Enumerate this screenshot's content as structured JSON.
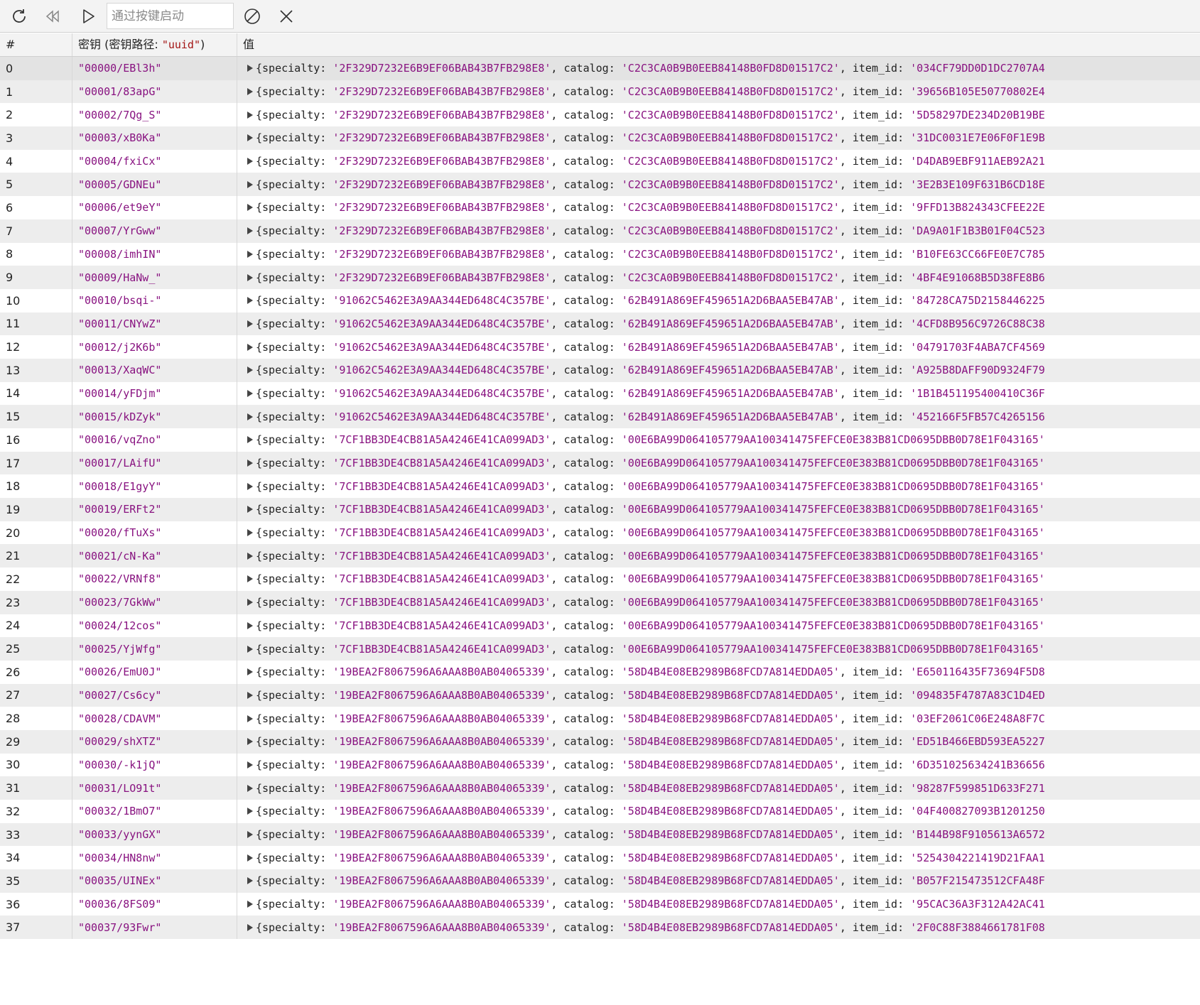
{
  "toolbar": {
    "refresh_icon": "refresh-icon",
    "rewind_icon": "rewind-icon",
    "play_icon": "play-icon",
    "filter_placeholder": "通过按键启动",
    "clear_icon": "clear-icon",
    "close_icon": "close-icon"
  },
  "columns": {
    "index": "#",
    "key_prefix": "密钥 (密钥路径: ",
    "key_path": "\"uuid\"",
    "key_suffix": ")",
    "value": "值"
  },
  "rows": [
    {
      "index": "0",
      "key": "\"00000/EBl3h\"",
      "specialty": "'2F329D7232E6B9EF06BAB43B7FB298E8'",
      "catalog": "'C2C3CA0B9B0EEB84148B0FD8D01517C2'",
      "item_id": "'034CF79DD0D1DC2707A4"
    },
    {
      "index": "1",
      "key": "\"00001/83apG\"",
      "specialty": "'2F329D7232E6B9EF06BAB43B7FB298E8'",
      "catalog": "'C2C3CA0B9B0EEB84148B0FD8D01517C2'",
      "item_id": "'39656B105E50770802E4"
    },
    {
      "index": "2",
      "key": "\"00002/7Qg_S\"",
      "specialty": "'2F329D7232E6B9EF06BAB43B7FB298E8'",
      "catalog": "'C2C3CA0B9B0EEB84148B0FD8D01517C2'",
      "item_id": "'5D58297DE234D20B19BE"
    },
    {
      "index": "3",
      "key": "\"00003/xB0Ka\"",
      "specialty": "'2F329D7232E6B9EF06BAB43B7FB298E8'",
      "catalog": "'C2C3CA0B9B0EEB84148B0FD8D01517C2'",
      "item_id": "'31DC0031E7E06F0F1E9B"
    },
    {
      "index": "4",
      "key": "\"00004/fxiCx\"",
      "specialty": "'2F329D7232E6B9EF06BAB43B7FB298E8'",
      "catalog": "'C2C3CA0B9B0EEB84148B0FD8D01517C2'",
      "item_id": "'D4DAB9EBF911AEB92A21"
    },
    {
      "index": "5",
      "key": "\"00005/GDNEu\"",
      "specialty": "'2F329D7232E6B9EF06BAB43B7FB298E8'",
      "catalog": "'C2C3CA0B9B0EEB84148B0FD8D01517C2'",
      "item_id": "'3E2B3E109F631B6CD18E"
    },
    {
      "index": "6",
      "key": "\"00006/et9eY\"",
      "specialty": "'2F329D7232E6B9EF06BAB43B7FB298E8'",
      "catalog": "'C2C3CA0B9B0EEB84148B0FD8D01517C2'",
      "item_id": "'9FFD13B824343CFEE22E"
    },
    {
      "index": "7",
      "key": "\"00007/YrGww\"",
      "specialty": "'2F329D7232E6B9EF06BAB43B7FB298E8'",
      "catalog": "'C2C3CA0B9B0EEB84148B0FD8D01517C2'",
      "item_id": "'DA9A01F1B3B01F04C523"
    },
    {
      "index": "8",
      "key": "\"00008/imhIN\"",
      "specialty": "'2F329D7232E6B9EF06BAB43B7FB298E8'",
      "catalog": "'C2C3CA0B9B0EEB84148B0FD8D01517C2'",
      "item_id": "'B10FE63CC66FE0E7C785"
    },
    {
      "index": "9",
      "key": "\"00009/HaNw_\"",
      "specialty": "'2F329D7232E6B9EF06BAB43B7FB298E8'",
      "catalog": "'C2C3CA0B9B0EEB84148B0FD8D01517C2'",
      "item_id": "'4BF4E91068B5D38FE8B6"
    },
    {
      "index": "10",
      "key": "\"00010/bsqi-\"",
      "specialty": "'91062C5462E3A9AA344ED648C4C357BE'",
      "catalog": "'62B491A869EF459651A2D6BAA5EB47AB'",
      "item_id": "'84728CA75D2158446225"
    },
    {
      "index": "11",
      "key": "\"00011/CNYwZ\"",
      "specialty": "'91062C5462E3A9AA344ED648C4C357BE'",
      "catalog": "'62B491A869EF459651A2D6BAA5EB47AB'",
      "item_id": "'4CFD8B956C9726C88C38"
    },
    {
      "index": "12",
      "key": "\"00012/j2K6b\"",
      "specialty": "'91062C5462E3A9AA344ED648C4C357BE'",
      "catalog": "'62B491A869EF459651A2D6BAA5EB47AB'",
      "item_id": "'04791703F4ABA7CF4569"
    },
    {
      "index": "13",
      "key": "\"00013/XaqWC\"",
      "specialty": "'91062C5462E3A9AA344ED648C4C357BE'",
      "catalog": "'62B491A869EF459651A2D6BAA5EB47AB'",
      "item_id": "'A925B8DAFF90D9324F79"
    },
    {
      "index": "14",
      "key": "\"00014/yFDjm\"",
      "specialty": "'91062C5462E3A9AA344ED648C4C357BE'",
      "catalog": "'62B491A869EF459651A2D6BAA5EB47AB'",
      "item_id": "'1B1B451195400410C36F"
    },
    {
      "index": "15",
      "key": "\"00015/kDZyk\"",
      "specialty": "'91062C5462E3A9AA344ED648C4C357BE'",
      "catalog": "'62B491A869EF459651A2D6BAA5EB47AB'",
      "item_id": "'452166F5FB57C4265156"
    },
    {
      "index": "16",
      "key": "\"00016/vqZno\"",
      "specialty": "'7CF1BB3DE4CB81A5A4246E41CA099AD3'",
      "catalog": "'00E6BA99D064105779AA100341475FEFCE0E383B81CD0695DBB0D78E1F043165'",
      "item_id": ""
    },
    {
      "index": "17",
      "key": "\"00017/LAifU\"",
      "specialty": "'7CF1BB3DE4CB81A5A4246E41CA099AD3'",
      "catalog": "'00E6BA99D064105779AA100341475FEFCE0E383B81CD0695DBB0D78E1F043165'",
      "item_id": ""
    },
    {
      "index": "18",
      "key": "\"00018/E1gyY\"",
      "specialty": "'7CF1BB3DE4CB81A5A4246E41CA099AD3'",
      "catalog": "'00E6BA99D064105779AA100341475FEFCE0E383B81CD0695DBB0D78E1F043165'",
      "item_id": ""
    },
    {
      "index": "19",
      "key": "\"00019/ERFt2\"",
      "specialty": "'7CF1BB3DE4CB81A5A4246E41CA099AD3'",
      "catalog": "'00E6BA99D064105779AA100341475FEFCE0E383B81CD0695DBB0D78E1F043165'",
      "item_id": ""
    },
    {
      "index": "20",
      "key": "\"00020/fTuXs\"",
      "specialty": "'7CF1BB3DE4CB81A5A4246E41CA099AD3'",
      "catalog": "'00E6BA99D064105779AA100341475FEFCE0E383B81CD0695DBB0D78E1F043165'",
      "item_id": ""
    },
    {
      "index": "21",
      "key": "\"00021/cN-Ka\"",
      "specialty": "'7CF1BB3DE4CB81A5A4246E41CA099AD3'",
      "catalog": "'00E6BA99D064105779AA100341475FEFCE0E383B81CD0695DBB0D78E1F043165'",
      "item_id": ""
    },
    {
      "index": "22",
      "key": "\"00022/VRNf8\"",
      "specialty": "'7CF1BB3DE4CB81A5A4246E41CA099AD3'",
      "catalog": "'00E6BA99D064105779AA100341475FEFCE0E383B81CD0695DBB0D78E1F043165'",
      "item_id": ""
    },
    {
      "index": "23",
      "key": "\"00023/7GkWw\"",
      "specialty": "'7CF1BB3DE4CB81A5A4246E41CA099AD3'",
      "catalog": "'00E6BA99D064105779AA100341475FEFCE0E383B81CD0695DBB0D78E1F043165'",
      "item_id": ""
    },
    {
      "index": "24",
      "key": "\"00024/12cos\"",
      "specialty": "'7CF1BB3DE4CB81A5A4246E41CA099AD3'",
      "catalog": "'00E6BA99D064105779AA100341475FEFCE0E383B81CD0695DBB0D78E1F043165'",
      "item_id": ""
    },
    {
      "index": "25",
      "key": "\"00025/YjWfg\"",
      "specialty": "'7CF1BB3DE4CB81A5A4246E41CA099AD3'",
      "catalog": "'00E6BA99D064105779AA100341475FEFCE0E383B81CD0695DBB0D78E1F043165'",
      "item_id": ""
    },
    {
      "index": "26",
      "key": "\"00026/EmU0J\"",
      "specialty": "'19BEA2F8067596A6AAA8B0AB04065339'",
      "catalog": "'58D4B4E08EB2989B68FCD7A814EDDA05'",
      "item_id": "'E650116435F73694F5D8"
    },
    {
      "index": "27",
      "key": "\"00027/Cs6cy\"",
      "specialty": "'19BEA2F8067596A6AAA8B0AB04065339'",
      "catalog": "'58D4B4E08EB2989B68FCD7A814EDDA05'",
      "item_id": "'094835F4787A83C1D4ED"
    },
    {
      "index": "28",
      "key": "\"00028/CDAVM\"",
      "specialty": "'19BEA2F8067596A6AAA8B0AB04065339'",
      "catalog": "'58D4B4E08EB2989B68FCD7A814EDDA05'",
      "item_id": "'03EF2061C06E248A8F7C"
    },
    {
      "index": "29",
      "key": "\"00029/shXTZ\"",
      "specialty": "'19BEA2F8067596A6AAA8B0AB04065339'",
      "catalog": "'58D4B4E08EB2989B68FCD7A814EDDA05'",
      "item_id": "'ED51B466EBD593EA5227"
    },
    {
      "index": "30",
      "key": "\"00030/-k1jQ\"",
      "specialty": "'19BEA2F8067596A6AAA8B0AB04065339'",
      "catalog": "'58D4B4E08EB2989B68FCD7A814EDDA05'",
      "item_id": "'6D351025634241B36656"
    },
    {
      "index": "31",
      "key": "\"00031/LO91t\"",
      "specialty": "'19BEA2F8067596A6AAA8B0AB04065339'",
      "catalog": "'58D4B4E08EB2989B68FCD7A814EDDA05'",
      "item_id": "'98287F599851D633F271"
    },
    {
      "index": "32",
      "key": "\"00032/1BmO7\"",
      "specialty": "'19BEA2F8067596A6AAA8B0AB04065339'",
      "catalog": "'58D4B4E08EB2989B68FCD7A814EDDA05'",
      "item_id": "'04F400827093B1201250"
    },
    {
      "index": "33",
      "key": "\"00033/yynGX\"",
      "specialty": "'19BEA2F8067596A6AAA8B0AB04065339'",
      "catalog": "'58D4B4E08EB2989B68FCD7A814EDDA05'",
      "item_id": "'B144B98F9105613A6572"
    },
    {
      "index": "34",
      "key": "\"00034/HN8nw\"",
      "specialty": "'19BEA2F8067596A6AAA8B0AB04065339'",
      "catalog": "'58D4B4E08EB2989B68FCD7A814EDDA05'",
      "item_id": "'5254304221419D21FAA1"
    },
    {
      "index": "35",
      "key": "\"00035/UINEx\"",
      "specialty": "'19BEA2F8067596A6AAA8B0AB04065339'",
      "catalog": "'58D4B4E08EB2989B68FCD7A814EDDA05'",
      "item_id": "'B057F215473512CFA48F"
    },
    {
      "index": "36",
      "key": "\"00036/8FS09\"",
      "specialty": "'19BEA2F8067596A6AAA8B0AB04065339'",
      "catalog": "'58D4B4E08EB2989B68FCD7A814EDDA05'",
      "item_id": "'95CAC36A3F312A42AC41"
    },
    {
      "index": "37",
      "key": "\"00037/93Fwr\"",
      "specialty": "'19BEA2F8067596A6AAA8B0AB04065339'",
      "catalog": "'58D4B4E08EB2989B68FCD7A814EDDA05'",
      "item_id": "'2F0C88F3884661781F08"
    }
  ],
  "labels": {
    "open_brace": "{",
    "specialty": "specialty: ",
    "catalog": "catalog: ",
    "item_id": "item_id: ",
    "sep": ", "
  },
  "colors": {
    "string": "#881280",
    "selected_row": "#e3e3e3"
  }
}
